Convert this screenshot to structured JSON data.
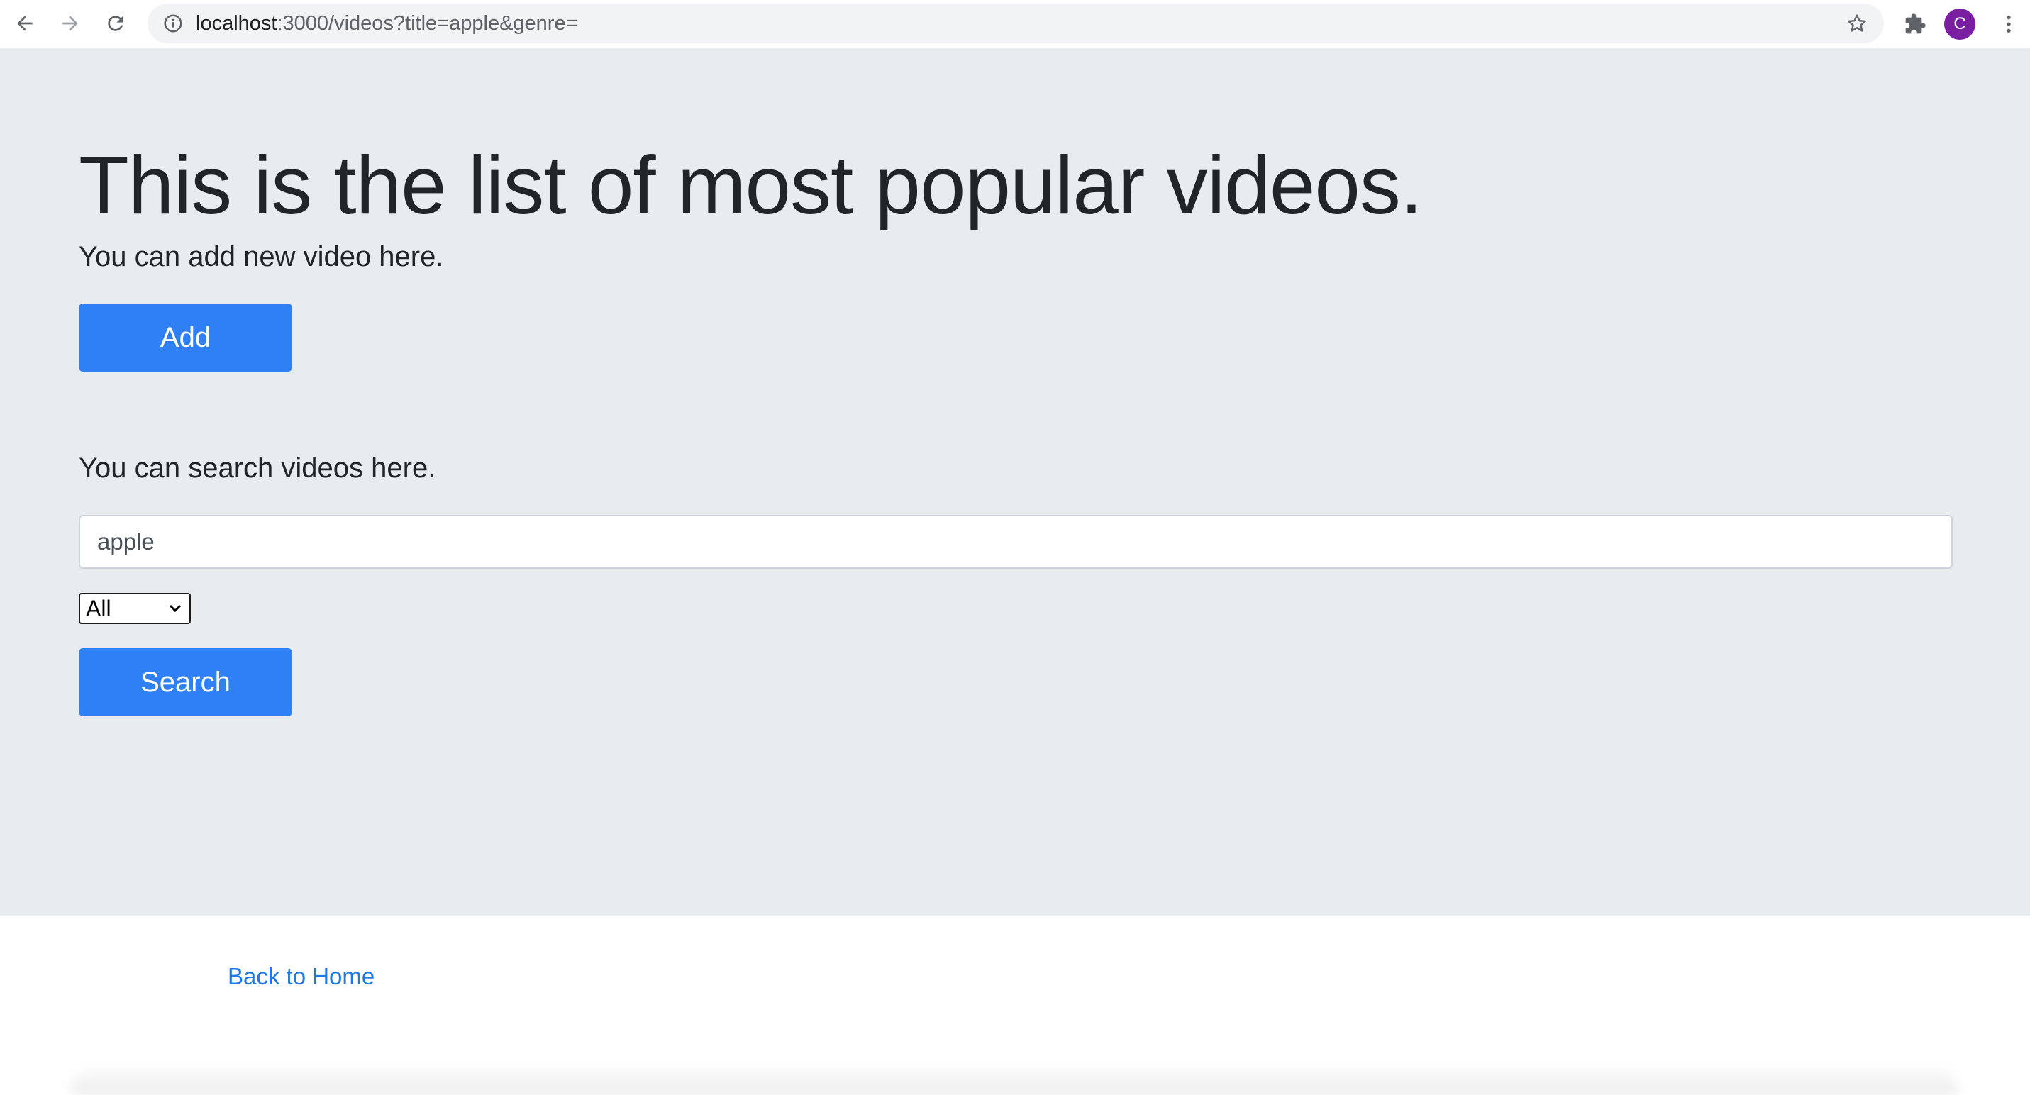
{
  "browser": {
    "url_host": "localhost",
    "url_path": ":3000/videos?title=apple&genre=",
    "profile_initial": "C",
    "icons": {
      "back": "back-arrow-icon",
      "forward": "forward-arrow-icon",
      "reload": "reload-icon",
      "info": "info-icon",
      "bookmark": "star-icon",
      "extensions": "puzzle-icon",
      "menu": "kebab-menu-icon"
    },
    "colors": {
      "avatar": "#7b1fa2"
    }
  },
  "page": {
    "title": "This is the list of most popular videos.",
    "add_prompt": "You can add new video here.",
    "add_button": "Add",
    "search_prompt": "You can search videos here.",
    "search_value": "apple",
    "genre_selected": "All",
    "search_button": "Search",
    "home_link": "Back to Home"
  },
  "colors": {
    "jumbotron_bg": "#e9ecef",
    "primary": "#2f80f5",
    "link": "#1e78e6"
  }
}
